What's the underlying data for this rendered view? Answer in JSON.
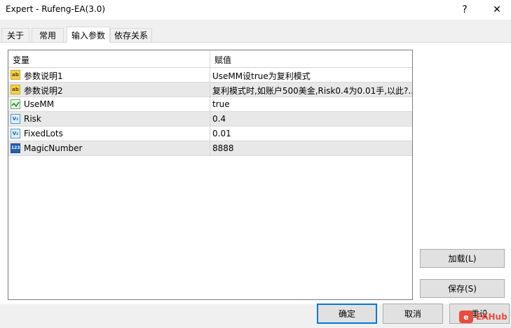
{
  "window": {
    "title": "Expert - Rufeng-EA(3.0)",
    "help_symbol": "?",
    "close_symbol": "✕"
  },
  "tabs": [
    {
      "label": "关于"
    },
    {
      "label": "常用"
    },
    {
      "label": "输入参数",
      "active": true
    },
    {
      "label": "依存关系"
    }
  ],
  "grid": {
    "headers": {
      "variable": "变量",
      "value": "赋值"
    },
    "rows": [
      {
        "type_icon": "ab",
        "icon_text": "ab",
        "name": "参数说明1",
        "value": "UseMM设true为复利模式"
      },
      {
        "type_icon": "ab",
        "icon_text": "ab",
        "name": "参数说明2",
        "value": "复利模式时,如账户500美金,Risk0.4为0.01手,以此?.."
      },
      {
        "type_icon": "bool",
        "icon_text": "",
        "name": "UseMM",
        "value": "true"
      },
      {
        "type_icon": "dbl",
        "icon_text": "V₂",
        "name": "Risk",
        "value": "0.4"
      },
      {
        "type_icon": "dbl",
        "icon_text": "V₂",
        "name": "FixedLots",
        "value": "0.01"
      },
      {
        "type_icon": "int",
        "icon_text": "123",
        "name": "MagicNumber",
        "value": "8888"
      }
    ]
  },
  "buttons": {
    "load": "加载(L)",
    "save": "保存(S)",
    "ok": "确定",
    "cancel": "取消",
    "reset": "重设"
  },
  "watermark": {
    "text": "EAHub"
  },
  "colors": {
    "accent": "#0078d7",
    "row_alt": "#e8e8e8",
    "string_icon": "#f5d14a",
    "watermark": "#e94b3c"
  }
}
